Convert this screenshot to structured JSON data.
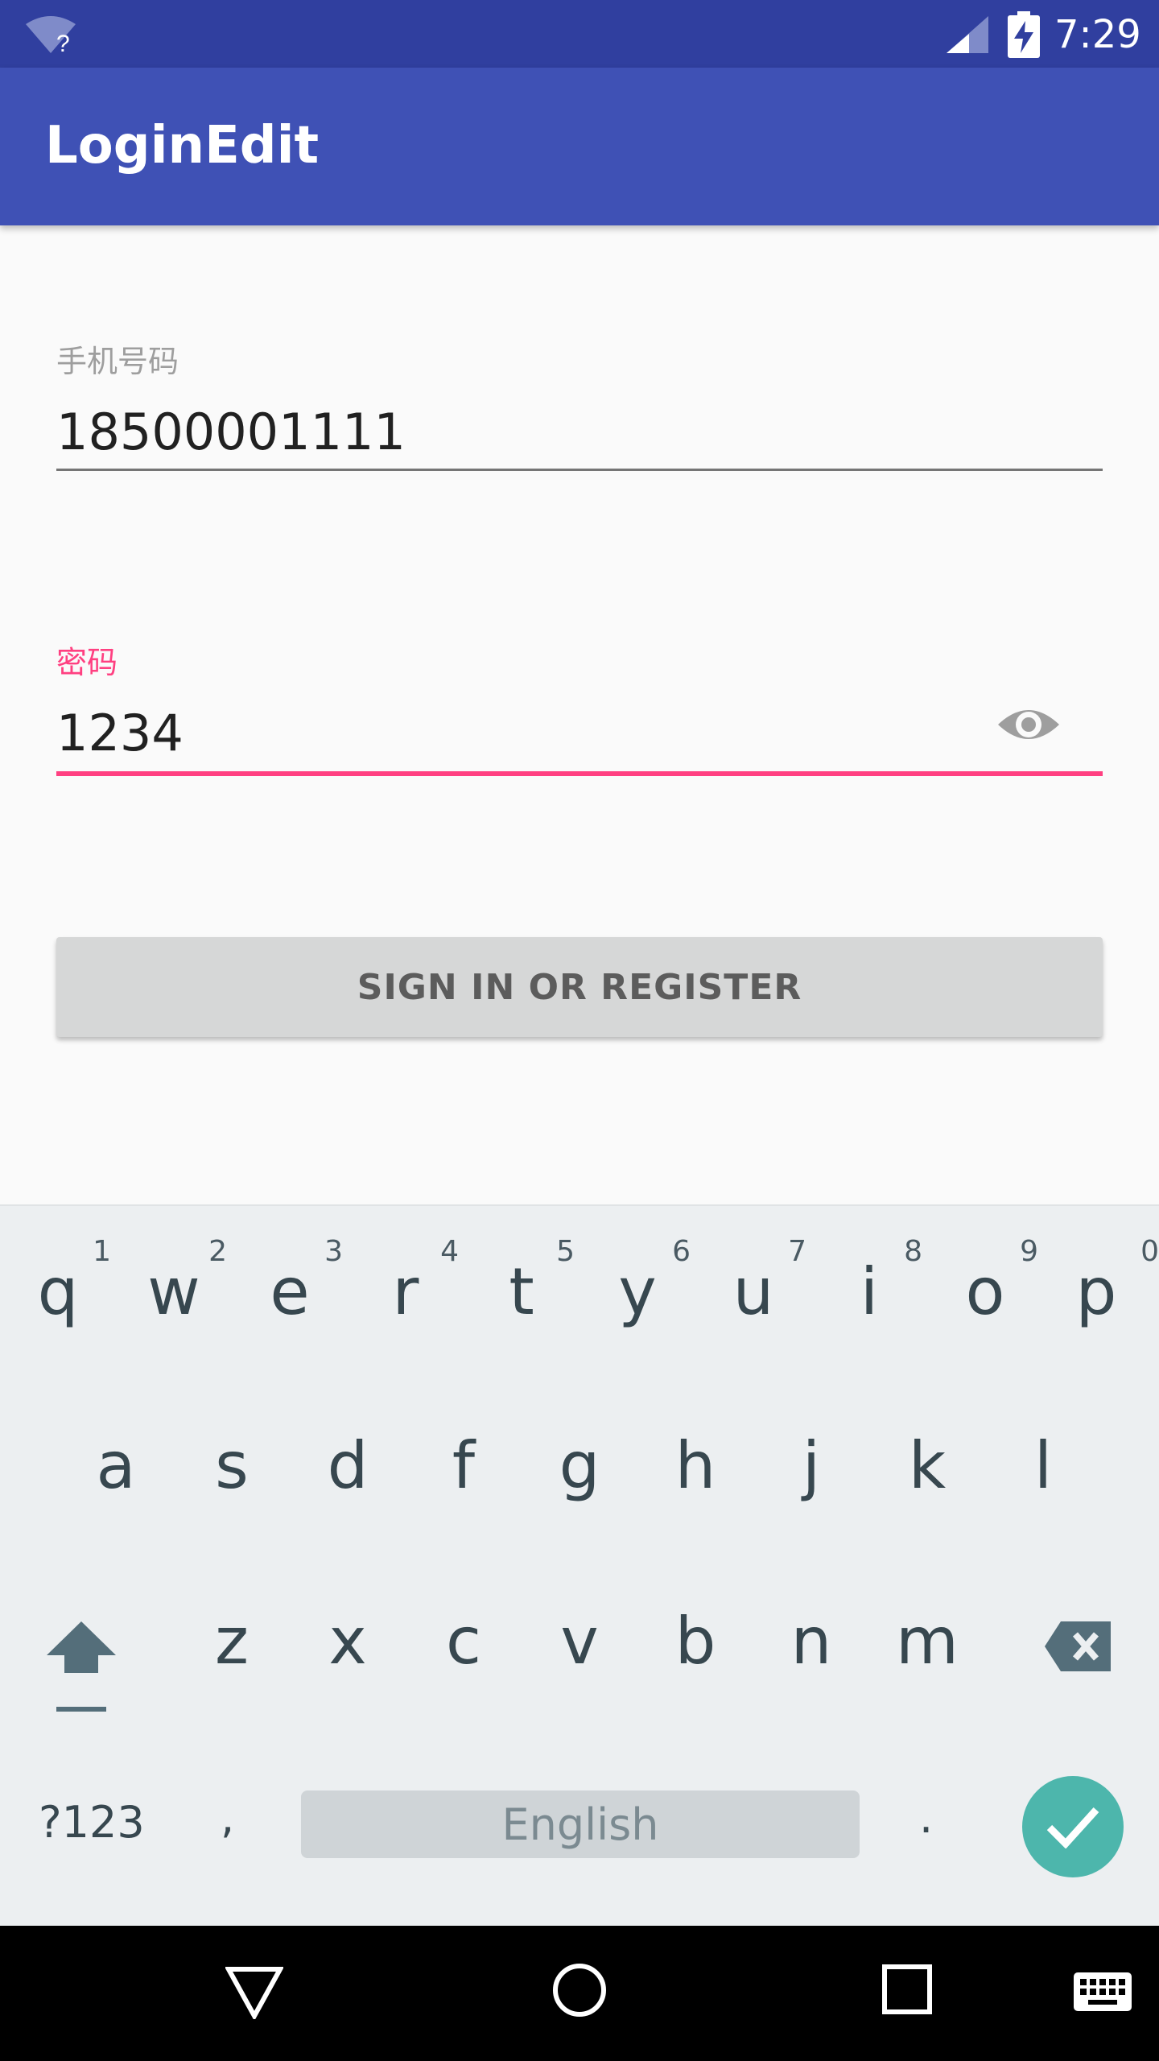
{
  "status_bar": {
    "time": "7:29",
    "wifi_badge": "?"
  },
  "app_bar": {
    "title": "LoginEdit"
  },
  "form": {
    "phone": {
      "label": "手机号码",
      "value": "18500001111"
    },
    "password": {
      "label": "密码",
      "value": "1234",
      "toggle_icon": "eye-icon"
    },
    "submit_label": "SIGN IN OR REGISTER"
  },
  "keyboard": {
    "row1": [
      {
        "k": "q",
        "h": "1"
      },
      {
        "k": "w",
        "h": "2"
      },
      {
        "k": "e",
        "h": "3"
      },
      {
        "k": "r",
        "h": "4"
      },
      {
        "k": "t",
        "h": "5"
      },
      {
        "k": "y",
        "h": "6"
      },
      {
        "k": "u",
        "h": "7"
      },
      {
        "k": "i",
        "h": "8"
      },
      {
        "k": "o",
        "h": "9"
      },
      {
        "k": "p",
        "h": "0"
      }
    ],
    "row2": [
      "a",
      "s",
      "d",
      "f",
      "g",
      "h",
      "j",
      "k",
      "l"
    ],
    "row3": [
      "z",
      "x",
      "c",
      "v",
      "b",
      "n",
      "m"
    ],
    "symbols_label": "?123",
    "comma": ",",
    "period": ".",
    "space_label": "English",
    "icons": [
      "shift-icon",
      "backspace-icon",
      "enter-check-icon"
    ]
  },
  "nav_bar": {
    "icons": [
      "back-icon",
      "home-icon",
      "recents-icon",
      "keyboard-switch-icon"
    ]
  },
  "colors": {
    "status_bar": "#303f9f",
    "app_bar": "#3f51b5",
    "accent": "#ff4081",
    "enter_key": "#4db6ac",
    "keyboard_bg": "#eceff1"
  }
}
